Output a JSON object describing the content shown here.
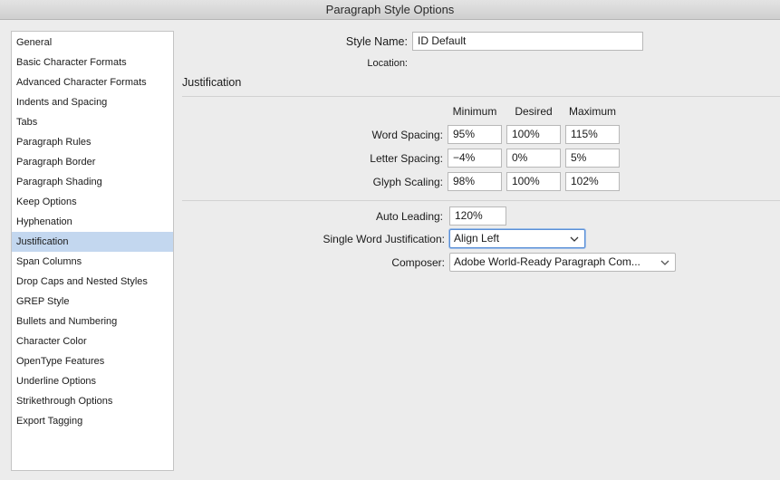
{
  "window": {
    "title": "Paragraph Style Options"
  },
  "sidebar": {
    "items": [
      {
        "label": "General"
      },
      {
        "label": "Basic Character Formats"
      },
      {
        "label": "Advanced Character Formats"
      },
      {
        "label": "Indents and Spacing"
      },
      {
        "label": "Tabs"
      },
      {
        "label": "Paragraph Rules"
      },
      {
        "label": "Paragraph Border"
      },
      {
        "label": "Paragraph Shading"
      },
      {
        "label": "Keep Options"
      },
      {
        "label": "Hyphenation"
      },
      {
        "label": "Justification",
        "selected": true
      },
      {
        "label": "Span Columns"
      },
      {
        "label": "Drop Caps and Nested Styles"
      },
      {
        "label": "GREP Style"
      },
      {
        "label": "Bullets and Numbering"
      },
      {
        "label": "Character Color"
      },
      {
        "label": "OpenType Features"
      },
      {
        "label": "Underline Options"
      },
      {
        "label": "Strikethrough Options"
      },
      {
        "label": "Export Tagging"
      }
    ]
  },
  "header": {
    "style_name_label": "Style Name:",
    "style_name_value": "ID Default",
    "location_label": "Location:"
  },
  "section": {
    "title": "Justification"
  },
  "spacing": {
    "columns": {
      "min": "Minimum",
      "des": "Desired",
      "max": "Maximum"
    },
    "word": {
      "label": "Word Spacing:",
      "min": "95%",
      "des": "100%",
      "max": "115%"
    },
    "letter": {
      "label": "Letter Spacing:",
      "min": "−4%",
      "des": "0%",
      "max": "5%"
    },
    "glyph": {
      "label": "Glyph Scaling:",
      "min": "98%",
      "des": "100%",
      "max": "102%"
    }
  },
  "options": {
    "auto_leading_label": "Auto Leading:",
    "auto_leading_value": "120%",
    "single_word_label": "Single Word Justification:",
    "single_word_value": "Align Left",
    "composer_label": "Composer:",
    "composer_value": "Adobe World-Ready Paragraph Com..."
  },
  "colors": {
    "selected_bg": "#c3d7ef",
    "focus_border": "#5a8fd6"
  }
}
